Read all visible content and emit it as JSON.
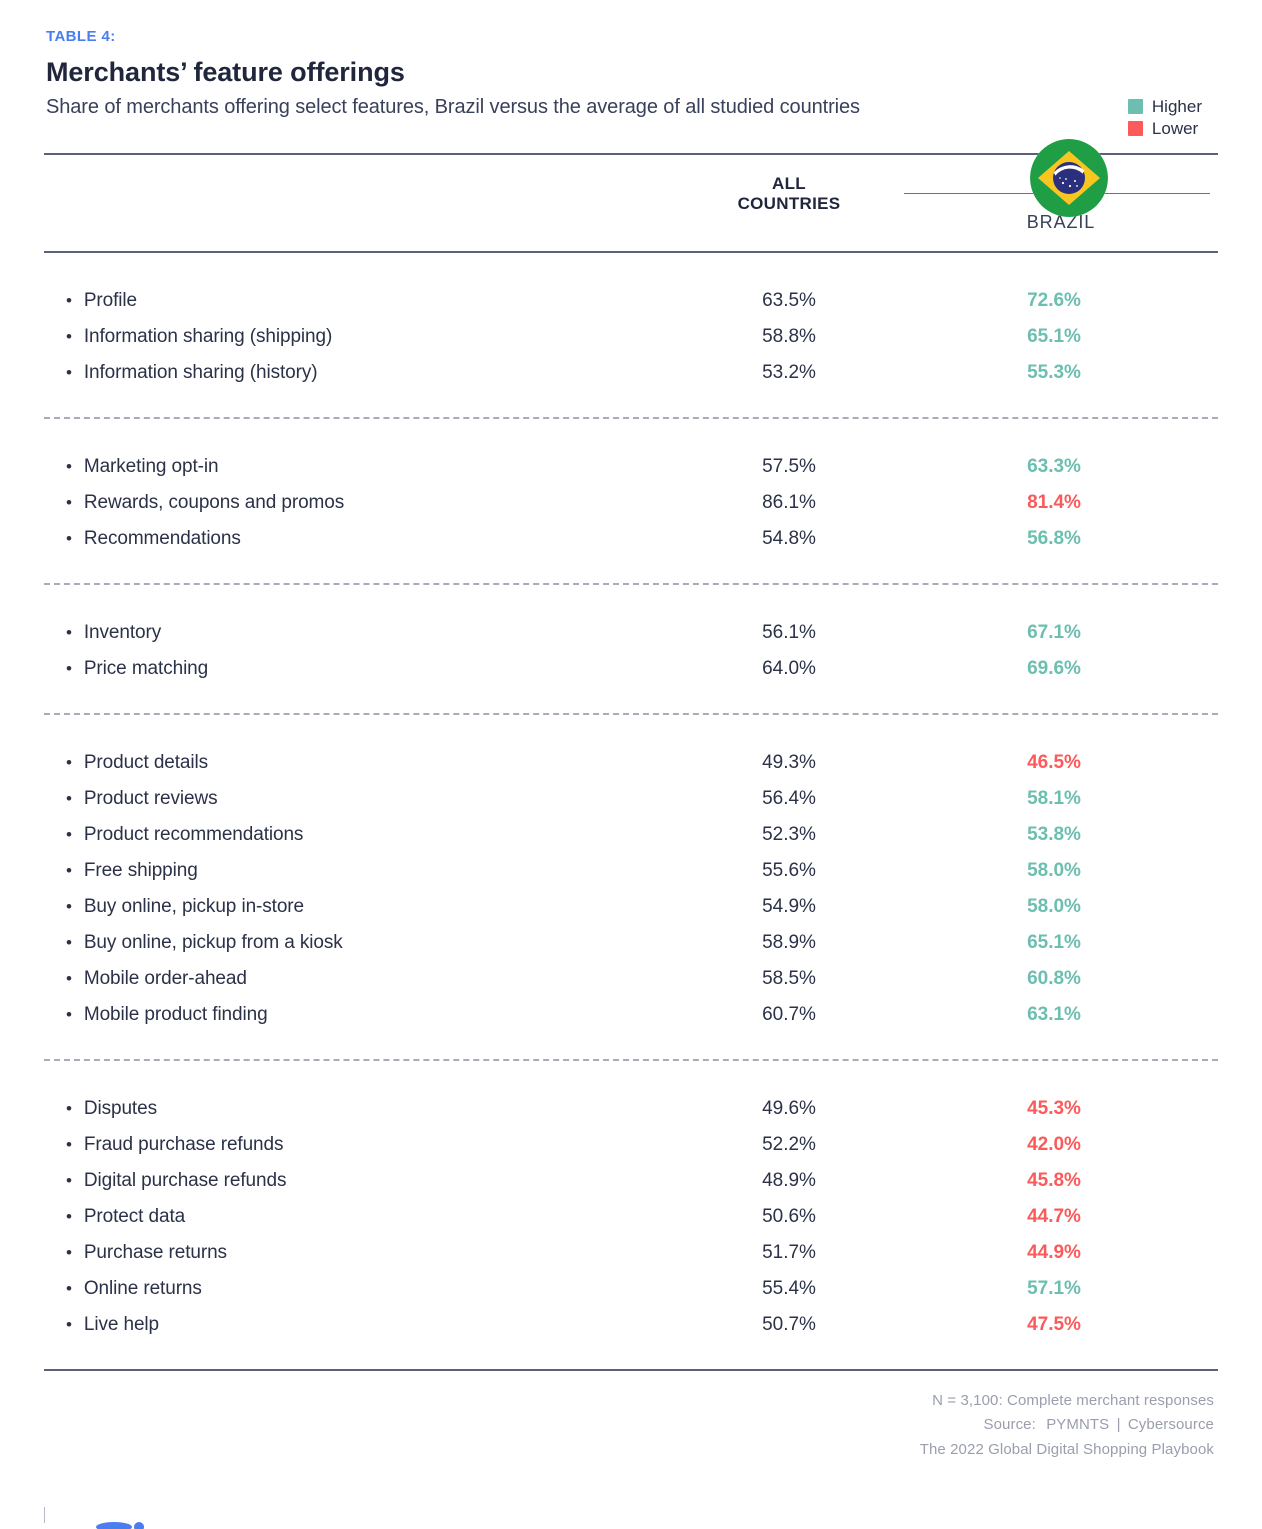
{
  "header": {
    "eyebrow": "TABLE 4:",
    "title": "Merchants’ feature offerings",
    "subtitle": "Share of merchants offering select features, Brazil versus the average of all studied countries"
  },
  "legend": {
    "items": [
      {
        "label": "Higher",
        "color": "#6cbfb0"
      },
      {
        "label": "Lower",
        "color": "#fc5a5a"
      }
    ]
  },
  "flag": {
    "name": "brazil-flag-icon",
    "green": "#1f9e46",
    "yellow": "#f9c621",
    "blue": "#2a2f7e"
  },
  "columns": {
    "feature_header": "",
    "all_countries_line1": "ALL",
    "all_countries_line2": "COUNTRIES",
    "brazil_header": "BRAZIL"
  },
  "chart_data": {
    "type": "table",
    "title": "Merchants’ feature offerings",
    "subtitle": "Share of merchants offering select features, Brazil versus the average of all studied countries",
    "columns": [
      "Feature",
      "ALL COUNTRIES",
      "BRAZIL"
    ],
    "units": "percent",
    "groups": [
      {
        "rows": [
          {
            "feature": "Profile",
            "all": "63.5%",
            "brazil": "72.6%",
            "status": "higher"
          },
          {
            "feature": "Information sharing (shipping)",
            "all": "58.8%",
            "brazil": "65.1%",
            "status": "higher"
          },
          {
            "feature": "Information sharing (history)",
            "all": "53.2%",
            "brazil": "55.3%",
            "status": "higher"
          }
        ]
      },
      {
        "rows": [
          {
            "feature": "Marketing opt-in",
            "all": "57.5%",
            "brazil": "63.3%",
            "status": "higher"
          },
          {
            "feature": "Rewards, coupons and promos",
            "all": "86.1%",
            "brazil": "81.4%",
            "status": "lower"
          },
          {
            "feature": "Recommendations",
            "all": "54.8%",
            "brazil": "56.8%",
            "status": "higher"
          }
        ]
      },
      {
        "rows": [
          {
            "feature": "Inventory",
            "all": "56.1%",
            "brazil": "67.1%",
            "status": "higher"
          },
          {
            "feature": "Price matching",
            "all": "64.0%",
            "brazil": "69.6%",
            "status": "higher"
          }
        ]
      },
      {
        "rows": [
          {
            "feature": "Product details",
            "all": "49.3%",
            "brazil": "46.5%",
            "status": "lower"
          },
          {
            "feature": "Product reviews",
            "all": "56.4%",
            "brazil": "58.1%",
            "status": "higher"
          },
          {
            "feature": "Product recommendations",
            "all": "52.3%",
            "brazil": "53.8%",
            "status": "higher"
          },
          {
            "feature": "Free shipping",
            "all": "55.6%",
            "brazil": "58.0%",
            "status": "higher"
          },
          {
            "feature": "Buy online, pickup in-store",
            "all": "54.9%",
            "brazil": "58.0%",
            "status": "higher"
          },
          {
            "feature": "Buy online, pickup from a kiosk",
            "all": "58.9%",
            "brazil": "65.1%",
            "status": "higher"
          },
          {
            "feature": "Mobile order-ahead",
            "all": "58.5%",
            "brazil": "60.8%",
            "status": "higher"
          },
          {
            "feature": "Mobile product finding",
            "all": "60.7%",
            "brazil": "63.1%",
            "status": "higher"
          }
        ]
      },
      {
        "rows": [
          {
            "feature": "Disputes",
            "all": "49.6%",
            "brazil": "45.3%",
            "status": "lower"
          },
          {
            "feature": "Fraud purchase refunds",
            "all": "52.2%",
            "brazil": "42.0%",
            "status": "lower"
          },
          {
            "feature": "Digital purchase refunds",
            "all": "48.9%",
            "brazil": "45.8%",
            "status": "lower"
          },
          {
            "feature": "Protect data",
            "all": "50.6%",
            "brazil": "44.7%",
            "status": "lower"
          },
          {
            "feature": "Purchase returns",
            "all": "51.7%",
            "brazil": "44.9%",
            "status": "lower"
          },
          {
            "feature": "Online returns",
            "all": "55.4%",
            "brazil": "57.1%",
            "status": "higher"
          },
          {
            "feature": "Live help",
            "all": "50.7%",
            "brazil": "47.5%",
            "status": "lower"
          }
        ]
      }
    ]
  },
  "footer": {
    "sample": "N = 3,100: Complete merchant responses",
    "source_label": "Source:",
    "source_a": "PYMNTS",
    "source_sep": "|",
    "source_b": "Cybersource",
    "publication": "The 2022 Global Digital Shopping Playbook"
  },
  "bullet_glyph": "•"
}
